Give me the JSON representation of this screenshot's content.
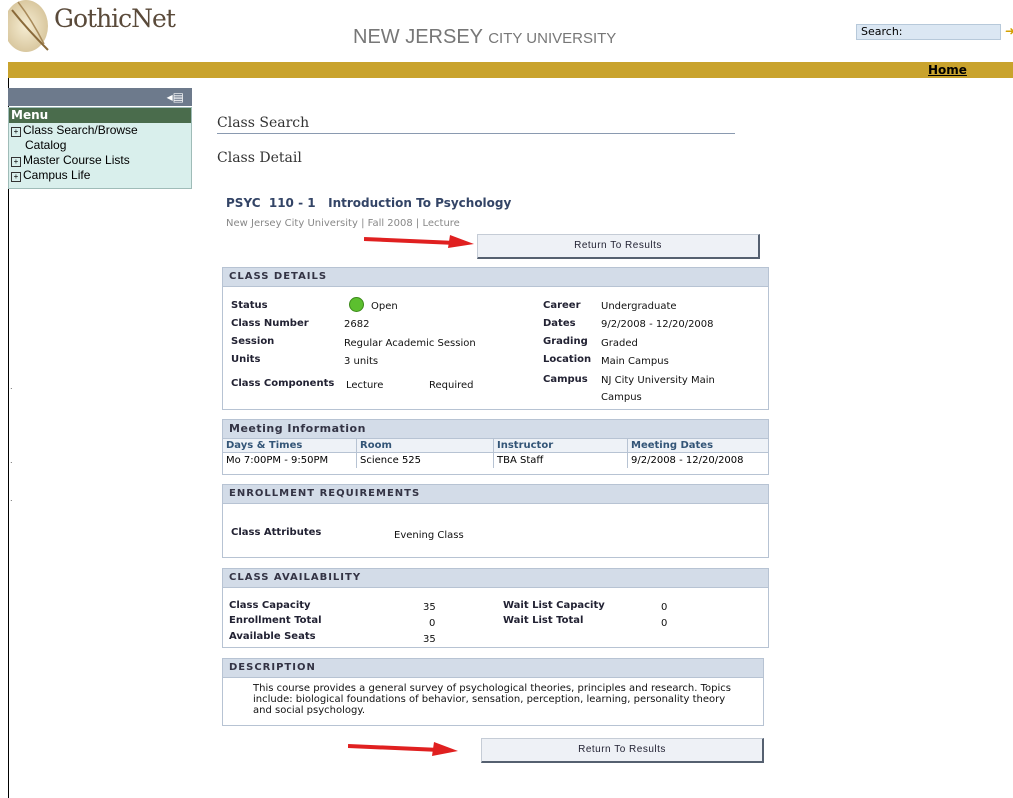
{
  "header": {
    "logo_text": "GothicNet",
    "university_first": "NEW JERSEY ",
    "university_second": "CITY UNIVERSITY",
    "search_label": "Search:",
    "home_link": "Home"
  },
  "menu": {
    "title": "Menu",
    "items": [
      {
        "label": "Class Search/Browse",
        "sub": "Catalog"
      },
      {
        "label": "Master Course Lists"
      },
      {
        "label": "Campus Life"
      }
    ]
  },
  "page": {
    "title": "Class Search",
    "section": "Class Detail",
    "course_title": "PSYC  110 - 1   Introduction To Psychology",
    "course_sub": "New Jersey City University | Fall 2008 | Lecture",
    "return_button": "Return To Results"
  },
  "class_details": {
    "heading": "CLASS DETAILS",
    "left": [
      {
        "label": "Status",
        "value": "Open"
      },
      {
        "label": "Class Number",
        "value": "2682"
      },
      {
        "label": "Session",
        "value": "Regular Academic Session"
      },
      {
        "label": "Units",
        "value": "3 units"
      },
      {
        "label": "Class Components",
        "value": "Lecture",
        "extra": "Required"
      }
    ],
    "right": [
      {
        "label": "Career",
        "value": "Undergraduate"
      },
      {
        "label": "Dates",
        "value": "9/2/2008 - 12/20/2008"
      },
      {
        "label": "Grading",
        "value": "Graded"
      },
      {
        "label": "Location",
        "value": "Main Campus"
      },
      {
        "label": "Campus",
        "value": "NJ City University Main",
        "value2": "Campus"
      }
    ],
    "status_color": "#5cbf2f"
  },
  "meeting": {
    "heading": "Meeting Information",
    "columns": [
      "Days & Times",
      "Room",
      "Instructor",
      "Meeting Dates"
    ],
    "rows": [
      [
        "Mo 7:00PM - 9:50PM",
        "Science 525",
        "TBA Staff",
        "9/2/2008 - 12/20/2008"
      ]
    ]
  },
  "enrollment": {
    "heading": "ENROLLMENT REQUIREMENTS",
    "label": "Class Attributes",
    "value": "Evening Class"
  },
  "availability": {
    "heading": "CLASS AVAILABILITY",
    "left": [
      {
        "label": "Class Capacity",
        "value": "35"
      },
      {
        "label": "Enrollment Total",
        "value": "0"
      },
      {
        "label": "Available Seats",
        "value": "35"
      }
    ],
    "right": [
      {
        "label": "Wait List Capacity",
        "value": "0"
      },
      {
        "label": "Wait List Total",
        "value": "0"
      }
    ]
  },
  "description": {
    "heading": "DESCRIPTION",
    "text": "This course provides a general survey of psychological theories, principles and research. Topics include: biological foundations of behavior, sensation, perception, learning, personality theory and social psychology."
  },
  "colors": {
    "gold": "#c9a32d",
    "panel_head": "#d3dce8",
    "arrow": "#e02020"
  }
}
